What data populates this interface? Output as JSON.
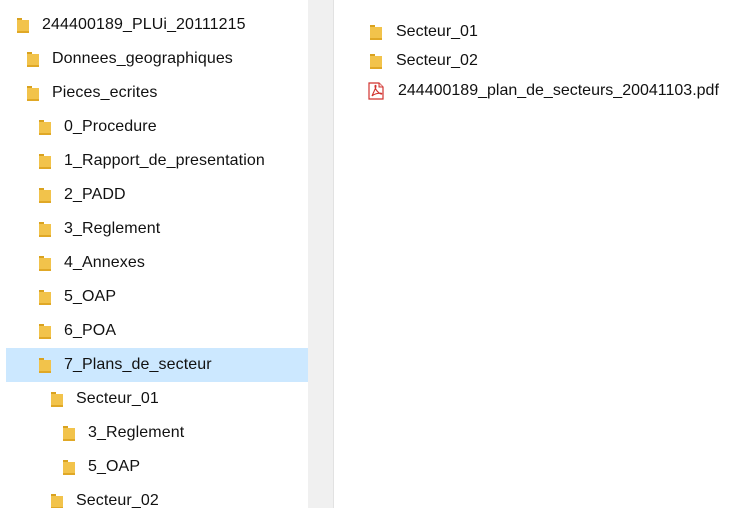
{
  "colors": {
    "folder": "#f2c34b",
    "folder_dark": "#d9a21f",
    "selection": "#cce8ff",
    "pdf_red": "#d1332f"
  },
  "nav_tree": {
    "items": [
      {
        "label": "244400189_PLUi_20111215",
        "icon": "folder-icon",
        "selected": false
      },
      {
        "label": "Donnees_geographiques",
        "icon": "folder-icon",
        "selected": false
      },
      {
        "label": "Pieces_ecrites",
        "icon": "folder-icon",
        "selected": false
      },
      {
        "label": "0_Procedure",
        "icon": "folder-icon",
        "selected": false
      },
      {
        "label": "1_Rapport_de_presentation",
        "icon": "folder-icon",
        "selected": false
      },
      {
        "label": "2_PADD",
        "icon": "folder-icon",
        "selected": false
      },
      {
        "label": "3_Reglement",
        "icon": "folder-icon",
        "selected": false
      },
      {
        "label": "4_Annexes",
        "icon": "folder-icon",
        "selected": false
      },
      {
        "label": "5_OAP",
        "icon": "folder-icon",
        "selected": false
      },
      {
        "label": "6_POA",
        "icon": "folder-icon",
        "selected": false
      },
      {
        "label": "7_Plans_de_secteur",
        "icon": "folder-icon",
        "selected": true
      },
      {
        "label": "Secteur_01",
        "icon": "folder-icon",
        "selected": false
      },
      {
        "label": "3_Reglement",
        "icon": "folder-icon",
        "selected": false
      },
      {
        "label": "5_OAP",
        "icon": "folder-icon",
        "selected": false
      },
      {
        "label": "Secteur_02",
        "icon": "folder-icon",
        "selected": false
      }
    ]
  },
  "content": {
    "items": [
      {
        "label": "Secteur_01",
        "icon": "folder-icon"
      },
      {
        "label": "Secteur_02",
        "icon": "folder-icon"
      },
      {
        "label": "244400189_plan_de_secteurs_20041103.pdf",
        "icon": "pdf-icon"
      }
    ]
  }
}
